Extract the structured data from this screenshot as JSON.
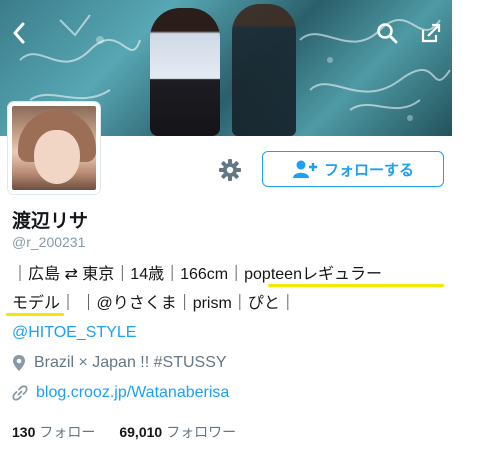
{
  "header": {
    "back_icon": "chevron-left-icon",
    "search_icon": "search-icon",
    "share_icon": "share-icon"
  },
  "profile": {
    "name": "渡辺リサ",
    "handle": "@r_200231",
    "bio_line1_a": "｜広島 ⇄ 東京｜14歳｜166cm｜",
    "bio_line1_b": "popteenレギュラー",
    "bio_line2_a": "モデル",
    "bio_line2_b": "｜ ｜@りさくま｜prism｜ぴと｜",
    "bio_line3": "@HITOE_STYLE",
    "location": "Brazil × Japan !! #STUSSY",
    "website": "blog.crooz.jp/Watanaberisa"
  },
  "actions": {
    "follow_label": "フォローする",
    "settings_icon": "gear-icon"
  },
  "stats": {
    "following_count": "130",
    "following_label": "フォロー",
    "followers_count": "69,010",
    "followers_label": "フォロワー"
  },
  "colors": {
    "accent": "#1da1f2",
    "highlight": "#f7e600",
    "muted": "#657786"
  }
}
